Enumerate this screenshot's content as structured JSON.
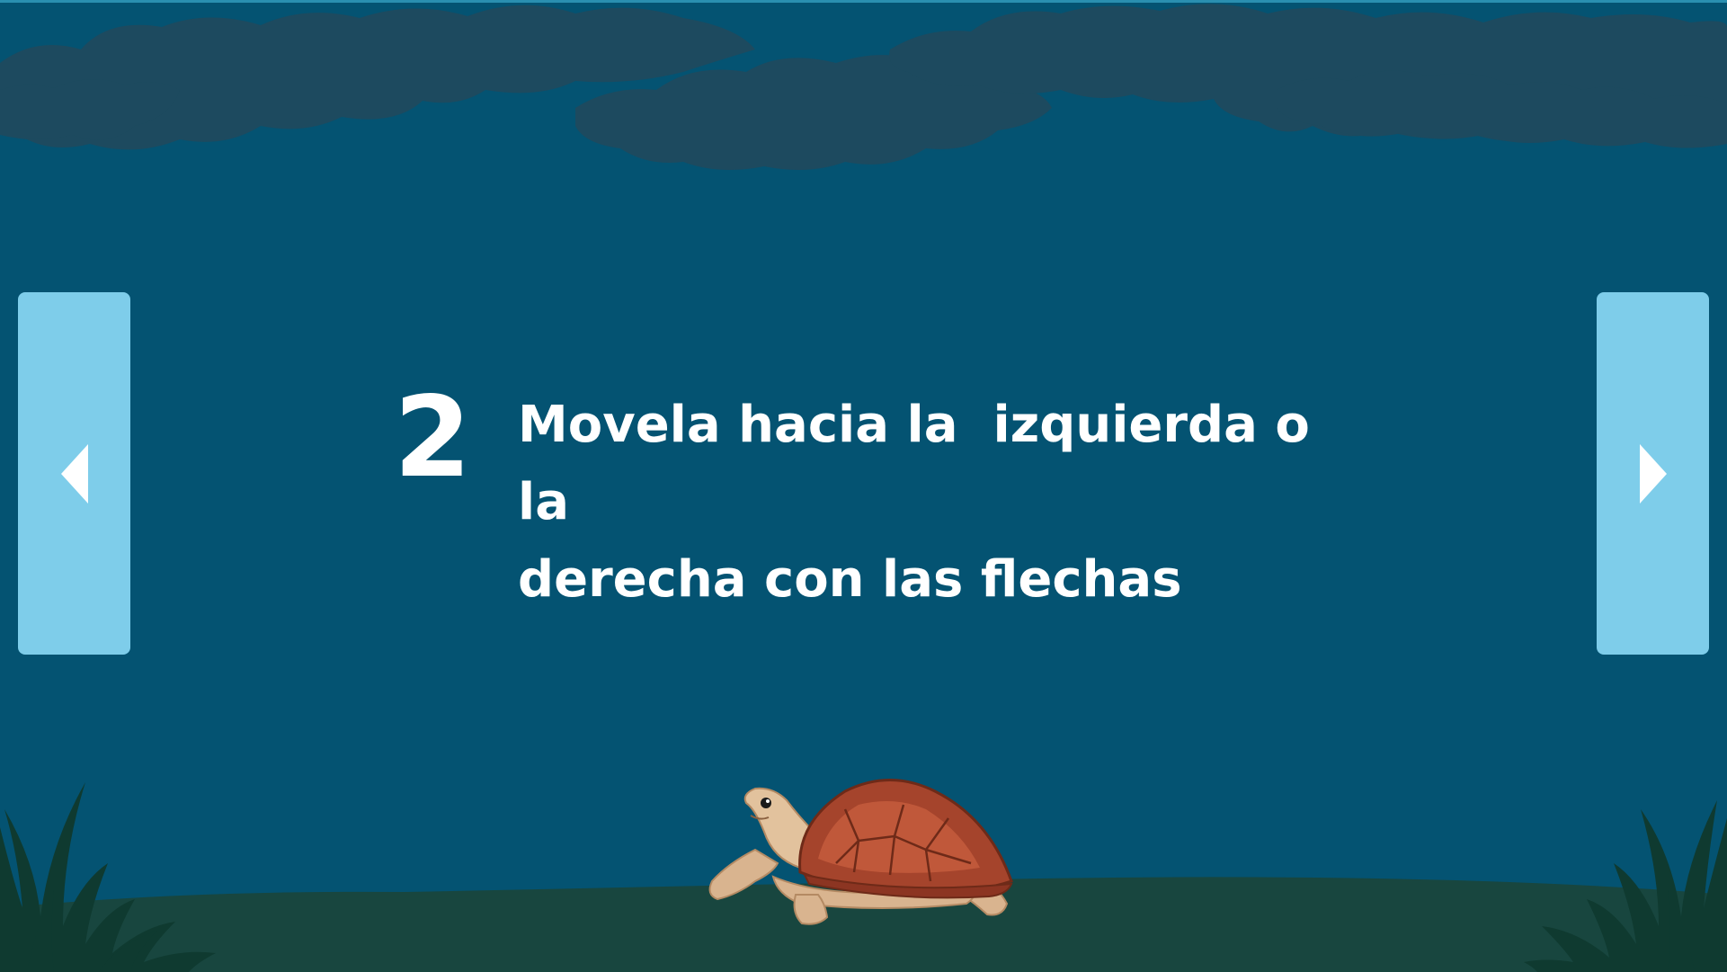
{
  "colors": {
    "sky": "#045372",
    "clouds": "#1f4a5e",
    "ground": "#18463f",
    "button_fill": "#7ecdea",
    "arrow": "#ffffff",
    "text": "#ffffff",
    "grass": "#0f3a30"
  },
  "navigation": {
    "prev_icon": "triangle-left-icon",
    "next_icon": "triangle-right-icon"
  },
  "step": {
    "number": "2",
    "instruction": "Movela hacia la  izquierda o la\nderecha con las flechas"
  },
  "scene": {
    "character": "turtle",
    "decorations": [
      "clouds",
      "grass",
      "ground"
    ]
  }
}
